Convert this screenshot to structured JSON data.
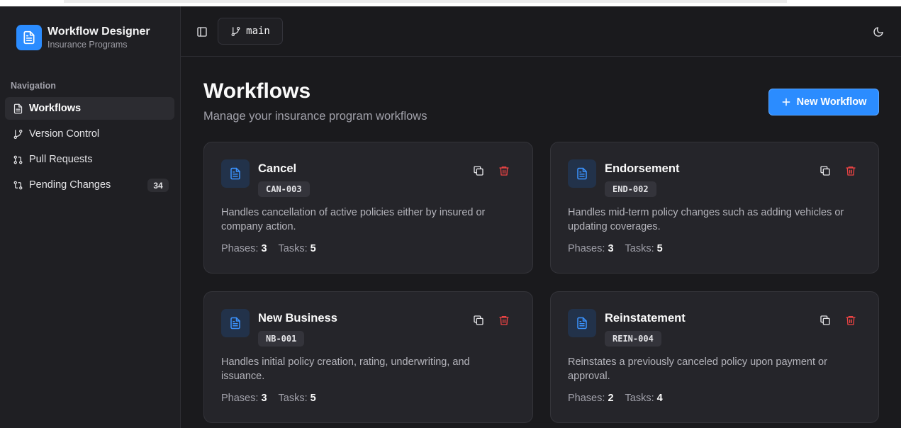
{
  "brand": {
    "title": "Workflow Designer",
    "subtitle": "Insurance Programs",
    "icon": "document-icon"
  },
  "sidebar": {
    "heading": "Navigation",
    "items": [
      {
        "label": "Workflows",
        "icon": "document-icon",
        "active": true
      },
      {
        "label": "Version Control",
        "icon": "git-branch-icon"
      },
      {
        "label": "Pull Requests",
        "icon": "git-pull-request-icon"
      },
      {
        "label": "Pending Changes",
        "icon": "git-compare-icon",
        "badge": "34"
      }
    ]
  },
  "topbar": {
    "branch": "main"
  },
  "page": {
    "title": "Workflows",
    "subtitle": "Manage your insurance program workflows",
    "new_button": "New Workflow"
  },
  "stats_labels": {
    "phases": "Phases:",
    "tasks": "Tasks:"
  },
  "workflows": [
    {
      "name": "Cancel",
      "code": "CAN-003",
      "description": "Handles cancellation of active policies either by insured or company action.",
      "phases": "3",
      "tasks": "5"
    },
    {
      "name": "Endorsement",
      "code": "END-002",
      "description": "Handles mid-term policy changes such as adding vehicles or updating coverages.",
      "phases": "3",
      "tasks": "5"
    },
    {
      "name": "New Business",
      "code": "NB-001",
      "description": "Handles initial policy creation, rating, underwriting, and issuance.",
      "phases": "3",
      "tasks": "5"
    },
    {
      "name": "Reinstatement",
      "code": "REIN-004",
      "description": "Reinstates a previously canceled policy upon payment or approval.",
      "phases": "2",
      "tasks": "4"
    }
  ],
  "colors": {
    "accent": "#2b8cff",
    "danger": "#ef4444",
    "background": "#1a1a1d",
    "card": "#25252a"
  }
}
